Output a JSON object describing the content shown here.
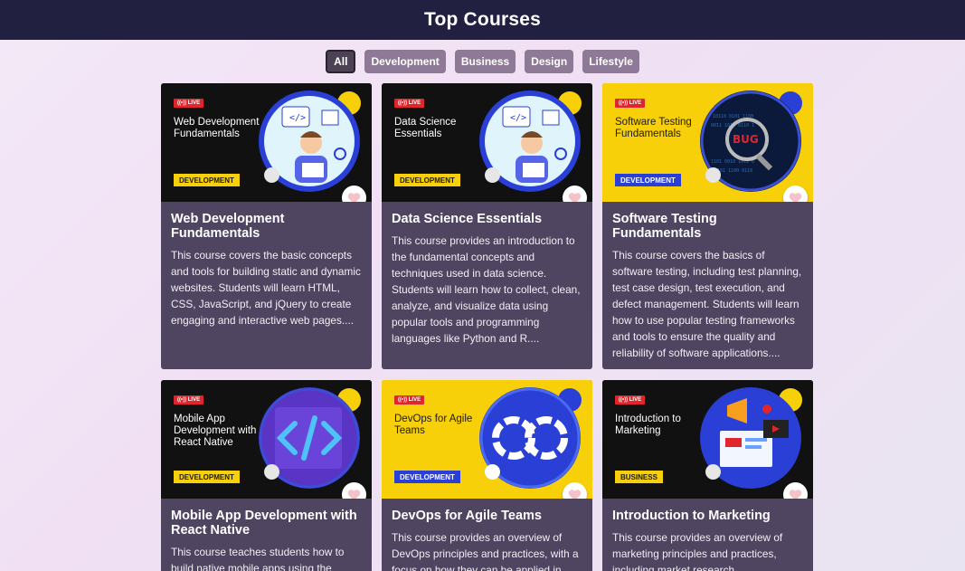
{
  "header": {
    "title": "Top Courses"
  },
  "filters": [
    "All",
    "Development",
    "Business",
    "Design",
    "Lifestyle"
  ],
  "active_filter": "All",
  "courses": [
    {
      "thumb_title": "Web Development Fundamentals",
      "live": "LIVE",
      "tag": "DEVELOPMENT",
      "title": "Web Development Fundamentals",
      "description": "This course covers the basic concepts and tools for building static and dynamic websites. Students will learn HTML, CSS, JavaScript, and jQuery to create engaging and interactive web pages...."
    },
    {
      "thumb_title": "Data Science Essentials",
      "live": "LIVE",
      "tag": "DEVELOPMENT",
      "title": "Data Science Essentials",
      "description": "This course provides an introduction to the fundamental concepts and techniques used in data science. Students will learn how to collect, clean, analyze, and visualize data using popular tools and programming languages like Python and R...."
    },
    {
      "thumb_title": "Software Testing Fundamentals",
      "live": "LIVE",
      "tag": "DEVELOPMENT",
      "title": "Software Testing Fundamentals",
      "description": "This course covers the basics of software testing, including test planning, test case design, test execution, and defect management. Students will learn how to use popular testing frameworks and tools to ensure the quality and reliability of software applications...."
    },
    {
      "thumb_title": "Mobile App Development with React Native",
      "live": "LIVE",
      "tag": "DEVELOPMENT",
      "title": "Mobile App Development with React Native",
      "description": "This course teaches students how to build native mobile apps using the"
    },
    {
      "thumb_title": "DevOps for Agile Teams",
      "live": "LIVE",
      "tag": "DEVELOPMENT",
      "title": "DevOps for Agile Teams",
      "description": "This course provides an overview of DevOps principles and practices, with a focus on how they can be applied in"
    },
    {
      "thumb_title": "Introduction to Marketing",
      "live": "LIVE",
      "tag": "BUSINESS",
      "title": "Introduction to Marketing",
      "description": "This course provides an overview of marketing principles and practices, including market research"
    }
  ],
  "icons": {
    "heart": "heart-icon",
    "live": "live-broadcast-icon"
  },
  "colors": {
    "header_bg": "#212040",
    "card_bg": "#4f4560",
    "filter_bg": "#8e7a96",
    "accent_yellow": "#f8d009",
    "accent_blue": "#2a3fd6",
    "live_red": "#e0262c",
    "heart_pink": "#f4c2c8"
  }
}
